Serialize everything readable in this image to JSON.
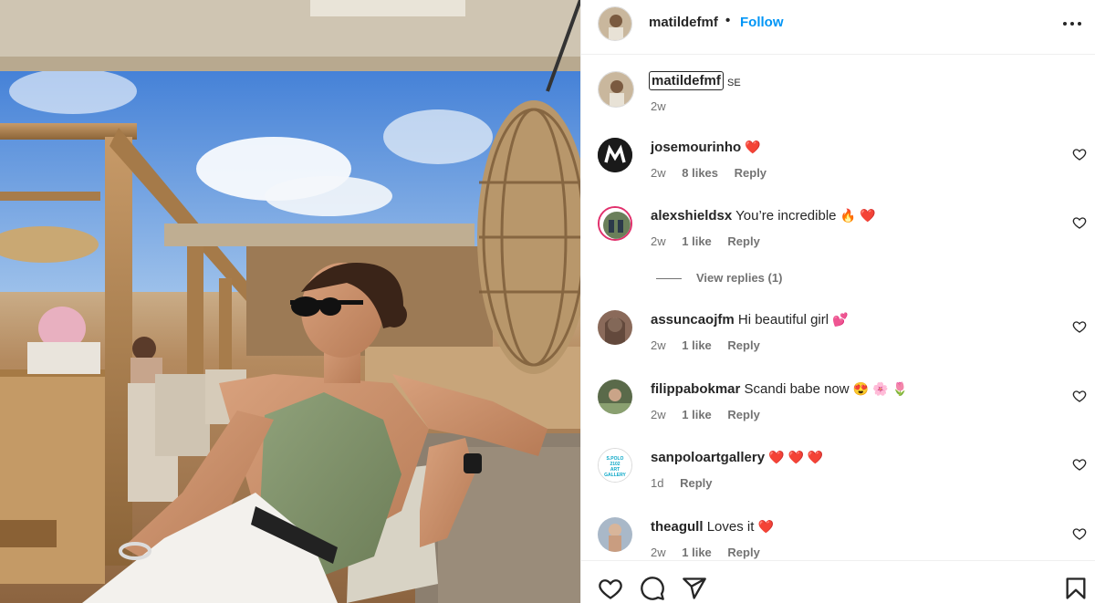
{
  "post": {
    "author": "matildefmf",
    "separator": "•",
    "follow_label": "Follow",
    "photo_alt": "Woman in sunglasses and green satin halter top sitting on a terrace lounge"
  },
  "caption": {
    "username": "matildefmf",
    "suffix": "SE",
    "time": "2w"
  },
  "comments": [
    {
      "username": "josemourinho",
      "text": "",
      "emoji": "❤️",
      "time": "2w",
      "likes": "8 likes",
      "reply": "Reply",
      "avatar_color": "#1a1a1a"
    },
    {
      "username": "alexshieldsx",
      "text": "You’re incredible",
      "emoji": "🔥 ❤️",
      "time": "2w",
      "likes": "1 like",
      "reply": "Reply",
      "avatar_color": "#6a7f5a"
    },
    {
      "username": "assuncaojfm",
      "text": "Hi beautiful girl",
      "emoji": "💕",
      "time": "2w",
      "likes": "1 like",
      "reply": "Reply",
      "avatar_color": "#8a6a5a"
    },
    {
      "username": "filippabokmar",
      "text": "Scandi babe now",
      "emoji": "😍 🌸 🌷",
      "time": "2w",
      "likes": "1 like",
      "reply": "Reply",
      "avatar_color": "#5a6a4a"
    },
    {
      "username": "sanpoloartgallery",
      "text": "",
      "emoji": "❤️ ❤️ ❤️",
      "time": "1d",
      "likes": "",
      "reply": "Reply",
      "avatar_color": "#ffffff"
    },
    {
      "username": "theagull",
      "text": "Loves it",
      "emoji": "❤️",
      "time": "2w",
      "likes": "1 like",
      "reply": "Reply",
      "avatar_color": "#a9b8c8"
    }
  ],
  "view_replies": "View replies (1)",
  "sanpolo_logo": "S.POLO 2102 ART GALLERY",
  "icons": {
    "more": "more-horizontal-icon",
    "heart": "heart-icon",
    "comment": "comment-icon",
    "share": "share-icon",
    "save": "bookmark-icon"
  },
  "colors": {
    "follow": "#0095f6",
    "text": "#262626",
    "muted": "#737373",
    "heart_red": "#ed4956"
  }
}
